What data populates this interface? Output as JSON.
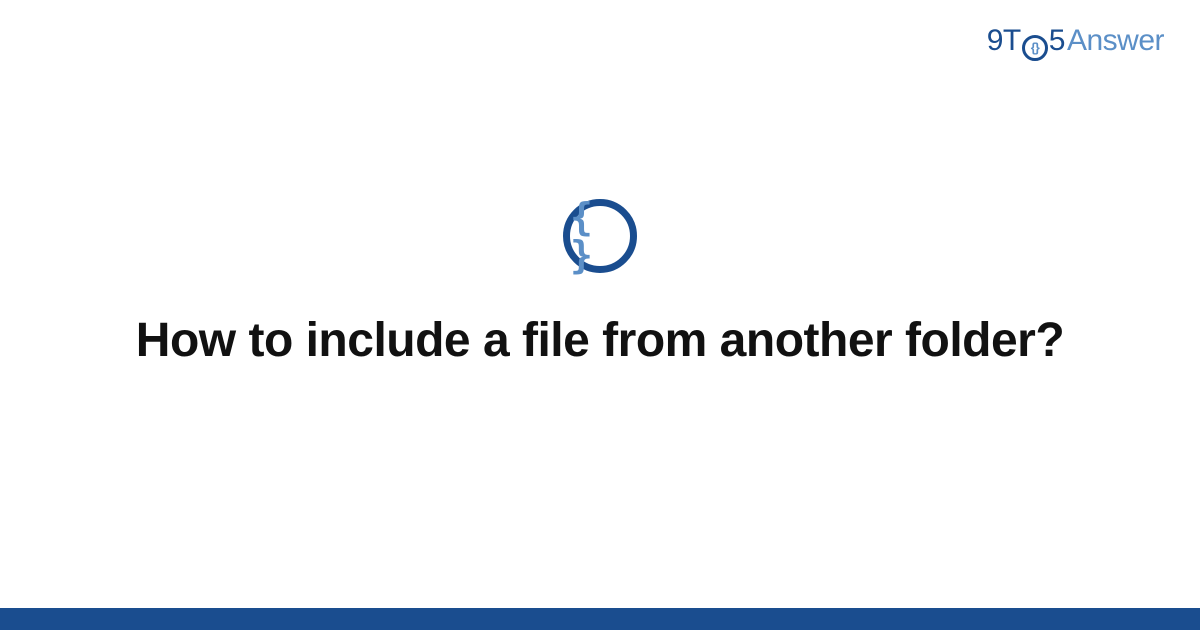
{
  "brand": {
    "part1": "9T",
    "inner": "{}",
    "part2": "5",
    "part3": "Answer"
  },
  "category": {
    "symbol": "{ }"
  },
  "question": {
    "title": "How to include a file from another folder?"
  },
  "colors": {
    "primary": "#1a4d8f",
    "secondary": "#5b8fc7"
  }
}
